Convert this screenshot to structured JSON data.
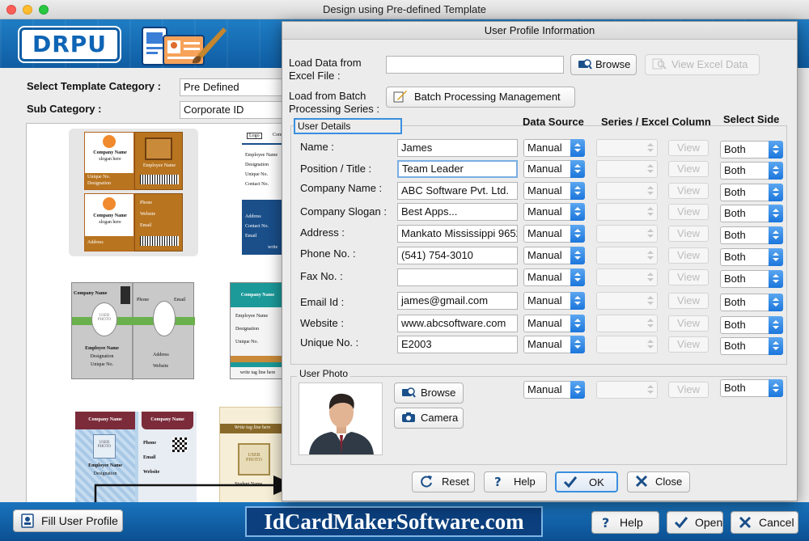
{
  "window": {
    "title": "Design using Pre-defined Template"
  },
  "header": {
    "logo_text": "DRPU"
  },
  "template": {
    "category_label": "Select Template Category :",
    "category_value": "Pre Defined",
    "subcategory_label": "Sub Category :",
    "subcategory_value": "Corporate ID"
  },
  "thumbs": {
    "t1": {
      "company_name": "Company Name",
      "slogan": "slogan here",
      "employee_name": "Employee Name",
      "unique_no": "Unique No.",
      "designation": "Designation",
      "user_photo": "USER PHOTO",
      "phone": "Phone",
      "website": "Website",
      "email": "Email",
      "address": "Address"
    },
    "t2": {
      "logo": "Logo",
      "company": "Com",
      "employee_name": "Employee Name",
      "designation": "Designation",
      "unique_no": "Unique No.",
      "contact_no": "Contact No.",
      "address": "Address",
      "contact_no2": "Contact No.",
      "email": "Email",
      "write": "write"
    },
    "t3": {
      "company_name": "Company Name",
      "phone": "Phone",
      "email": "Email",
      "user_photo": "USER PHOTO",
      "employee_name": "Employee Name",
      "designation": "Designation",
      "unique_no": "Unique No.",
      "address": "Address",
      "website": "Website"
    },
    "t4": {
      "company_name": "Company Name",
      "employee_name": "Employee Name",
      "designation": "Designation",
      "unique_no": "Unique No.",
      "tagline": "write tag line here"
    },
    "t5": {
      "company_name": "Company Name",
      "company_name2": "Company Name",
      "user_photo": "USER PHOTO",
      "employee_name": "Employee Name",
      "designation": "Designation",
      "phone": "Phone",
      "email": "Email",
      "website": "Website"
    },
    "t6": {
      "tagline": "Write tag line here",
      "user_photo": "USER PHOTO",
      "student_name": "Student Name"
    }
  },
  "bottom": {
    "fill_profile": "Fill User Profile",
    "site": "IdCardMakerSoftware.com",
    "help": "Help",
    "open": "Open",
    "cancel": "Cancel"
  },
  "dialog": {
    "title": "User Profile Information",
    "load_excel_label": "Load Data from Excel File :",
    "load_excel_value": "",
    "browse": "Browse",
    "view_excel": "View Excel Data",
    "load_batch_label": "Load from Batch Processing Series :",
    "batch_button": "Batch Processing Management",
    "user_details": "User Details",
    "columns": {
      "data_source": "Data Source",
      "series": "Series / Excel Column",
      "side": "Select Side"
    },
    "rows": [
      {
        "label": "Name :",
        "value": "James",
        "source": "Manual",
        "series": "",
        "view": "View",
        "side": "Both"
      },
      {
        "label": "Position / Title :",
        "value": "Team Leader",
        "source": "Manual",
        "series": "",
        "view": "View",
        "side": "Both"
      },
      {
        "label": "Company Name :",
        "value": "ABC Software Pvt. Ltd.",
        "source": "Manual",
        "series": "",
        "view": "View",
        "side": "Both"
      },
      {
        "label": "Company Slogan :",
        "value": "Best Apps...",
        "source": "Manual",
        "series": "",
        "view": "View",
        "side": "Both"
      },
      {
        "label": "Address :",
        "value": "Mankato Mississippi 96522",
        "source": "Manual",
        "series": "",
        "view": "View",
        "side": "Both"
      },
      {
        "label": "Phone No. :",
        "value": "(541) 754-3010",
        "source": "Manual",
        "series": "",
        "view": "View",
        "side": "Both"
      },
      {
        "label": "Fax No. :",
        "value": "",
        "source": "Manual",
        "series": "",
        "view": "View",
        "side": "Both"
      },
      {
        "label": "Email Id :",
        "value": "james@gmail.com",
        "source": "Manual",
        "series": "",
        "view": "View",
        "side": "Both"
      },
      {
        "label": "Website :",
        "value": "www.abcsoftware.com",
        "source": "Manual",
        "series": "",
        "view": "View",
        "side": "Both"
      },
      {
        "label": "Unique No. :",
        "value": "E2003",
        "source": "Manual",
        "series": "",
        "view": "View",
        "side": "Both"
      }
    ],
    "user_photo": {
      "title": "User Photo",
      "browse": "Browse",
      "camera": "Camera",
      "source": "Manual",
      "series": "",
      "view": "View",
      "side": "Both"
    },
    "buttons": {
      "reset": "Reset",
      "help": "Help",
      "ok": "OK",
      "close": "Close"
    }
  }
}
